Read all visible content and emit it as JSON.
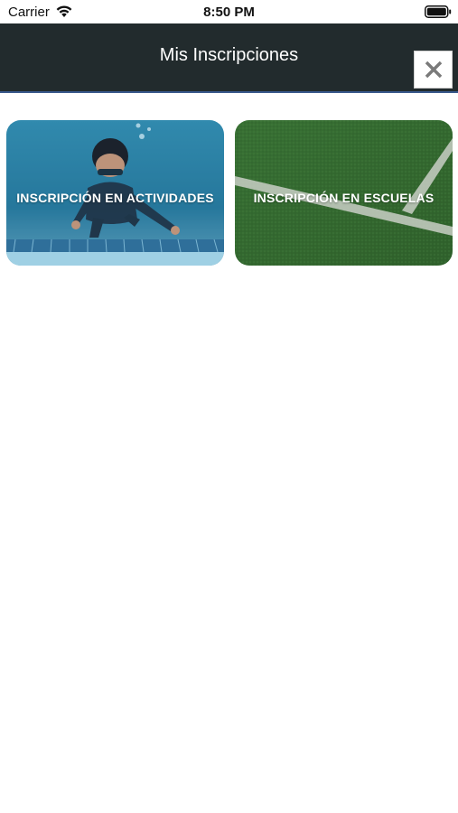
{
  "status": {
    "carrier": "Carrier",
    "time": "8:50 PM"
  },
  "nav": {
    "title": "Mis Inscripciones"
  },
  "tiles": [
    {
      "label": "INSCRIPCIÓN EN ACTIVIDADES"
    },
    {
      "label": "INSCRIPCIÓN EN ESCUELAS"
    }
  ],
  "colors": {
    "nav_bg": "#222b2d",
    "nav_border": "#3a5a8c",
    "pool": "#2f8fb8",
    "grass": "#3f7a3a"
  },
  "icons": {
    "wifi": "wifi-icon",
    "battery": "battery-icon",
    "close": "close-icon"
  }
}
